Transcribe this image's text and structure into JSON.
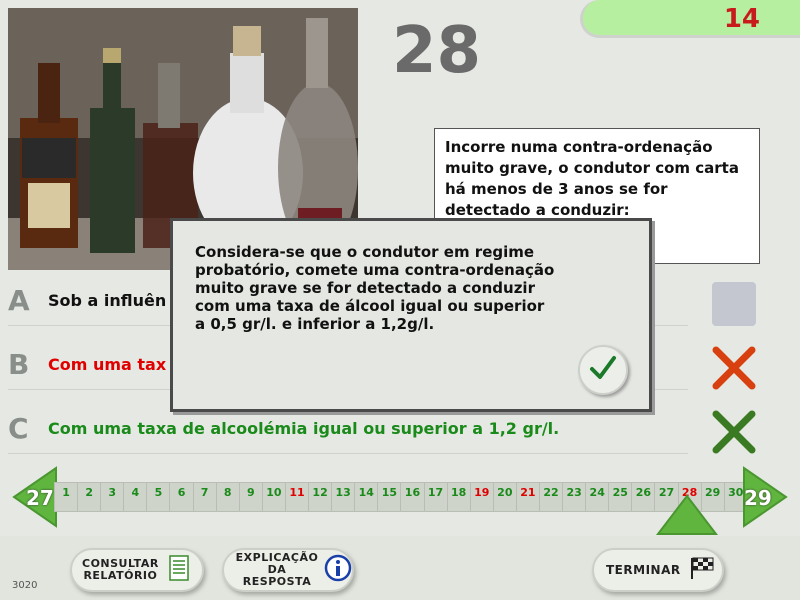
{
  "question": {
    "number": "28",
    "timer": "14",
    "text": "Incorre numa contra-ordenação muito grave, o condutor com carta há menos de 3 anos se for detectado a conduzir:"
  },
  "answers": [
    {
      "letter": "A",
      "text": "Sob a influên",
      "color": "#111111",
      "state": "unselected"
    },
    {
      "letter": "B",
      "text": "Com uma tax",
      "color": "#e00000",
      "state": "wrong"
    },
    {
      "letter": "C",
      "text": "Com uma taxa de alcoolémia igual ou superior a 1,2 gr/l.",
      "color": "#1a8a1a",
      "state": "correct"
    }
  ],
  "navigation": {
    "prev": "27",
    "next": "29",
    "numbers": [
      {
        "n": "1",
        "color": "#1a8a1a"
      },
      {
        "n": "2",
        "color": "#1a8a1a"
      },
      {
        "n": "3",
        "color": "#1a8a1a"
      },
      {
        "n": "4",
        "color": "#1a8a1a"
      },
      {
        "n": "5",
        "color": "#1a8a1a"
      },
      {
        "n": "6",
        "color": "#1a8a1a"
      },
      {
        "n": "7",
        "color": "#1a8a1a"
      },
      {
        "n": "8",
        "color": "#1a8a1a"
      },
      {
        "n": "9",
        "color": "#1a8a1a"
      },
      {
        "n": "10",
        "color": "#1a8a1a"
      },
      {
        "n": "11",
        "color": "#e00000"
      },
      {
        "n": "12",
        "color": "#1a8a1a"
      },
      {
        "n": "13",
        "color": "#1a8a1a"
      },
      {
        "n": "14",
        "color": "#1a8a1a"
      },
      {
        "n": "15",
        "color": "#1a8a1a"
      },
      {
        "n": "16",
        "color": "#1a8a1a"
      },
      {
        "n": "17",
        "color": "#1a8a1a"
      },
      {
        "n": "18",
        "color": "#1a8a1a"
      },
      {
        "n": "19",
        "color": "#e00000"
      },
      {
        "n": "20",
        "color": "#1a8a1a"
      },
      {
        "n": "21",
        "color": "#e00000"
      },
      {
        "n": "22",
        "color": "#1a8a1a"
      },
      {
        "n": "23",
        "color": "#1a8a1a"
      },
      {
        "n": "24",
        "color": "#1a8a1a"
      },
      {
        "n": "25",
        "color": "#1a8a1a"
      },
      {
        "n": "26",
        "color": "#1a8a1a"
      },
      {
        "n": "27",
        "color": "#1a8a1a"
      },
      {
        "n": "28",
        "color": "#e00000"
      },
      {
        "n": "29",
        "color": "#1a8a1a"
      },
      {
        "n": "30",
        "color": "#1a8a1a"
      }
    ],
    "current": "28"
  },
  "popup": {
    "text": "Considera-se que o condutor em regime probatório, comete uma contra-ordenação muito grave se for detectado a conduzir com uma taxa de álcool igual ou superior a 0,5 gr/l. e inferior a 1,2g/l.",
    "ok_icon": "checkmark-icon"
  },
  "buttons": {
    "report_line1": "CONSULTAR",
    "report_line2": "RELATÓRIO",
    "explain_line1": "EXPLICAÇÃO",
    "explain_line2": "DA RESPOSTA",
    "finish": "TERMINAR"
  },
  "footer_code": "3020",
  "colors": {
    "correct": "#1a8a1a",
    "wrong": "#e00000",
    "timer_bg": "#b7efa0",
    "timer_text": "#c81c1c",
    "arrow_green": "#5fb53e"
  }
}
